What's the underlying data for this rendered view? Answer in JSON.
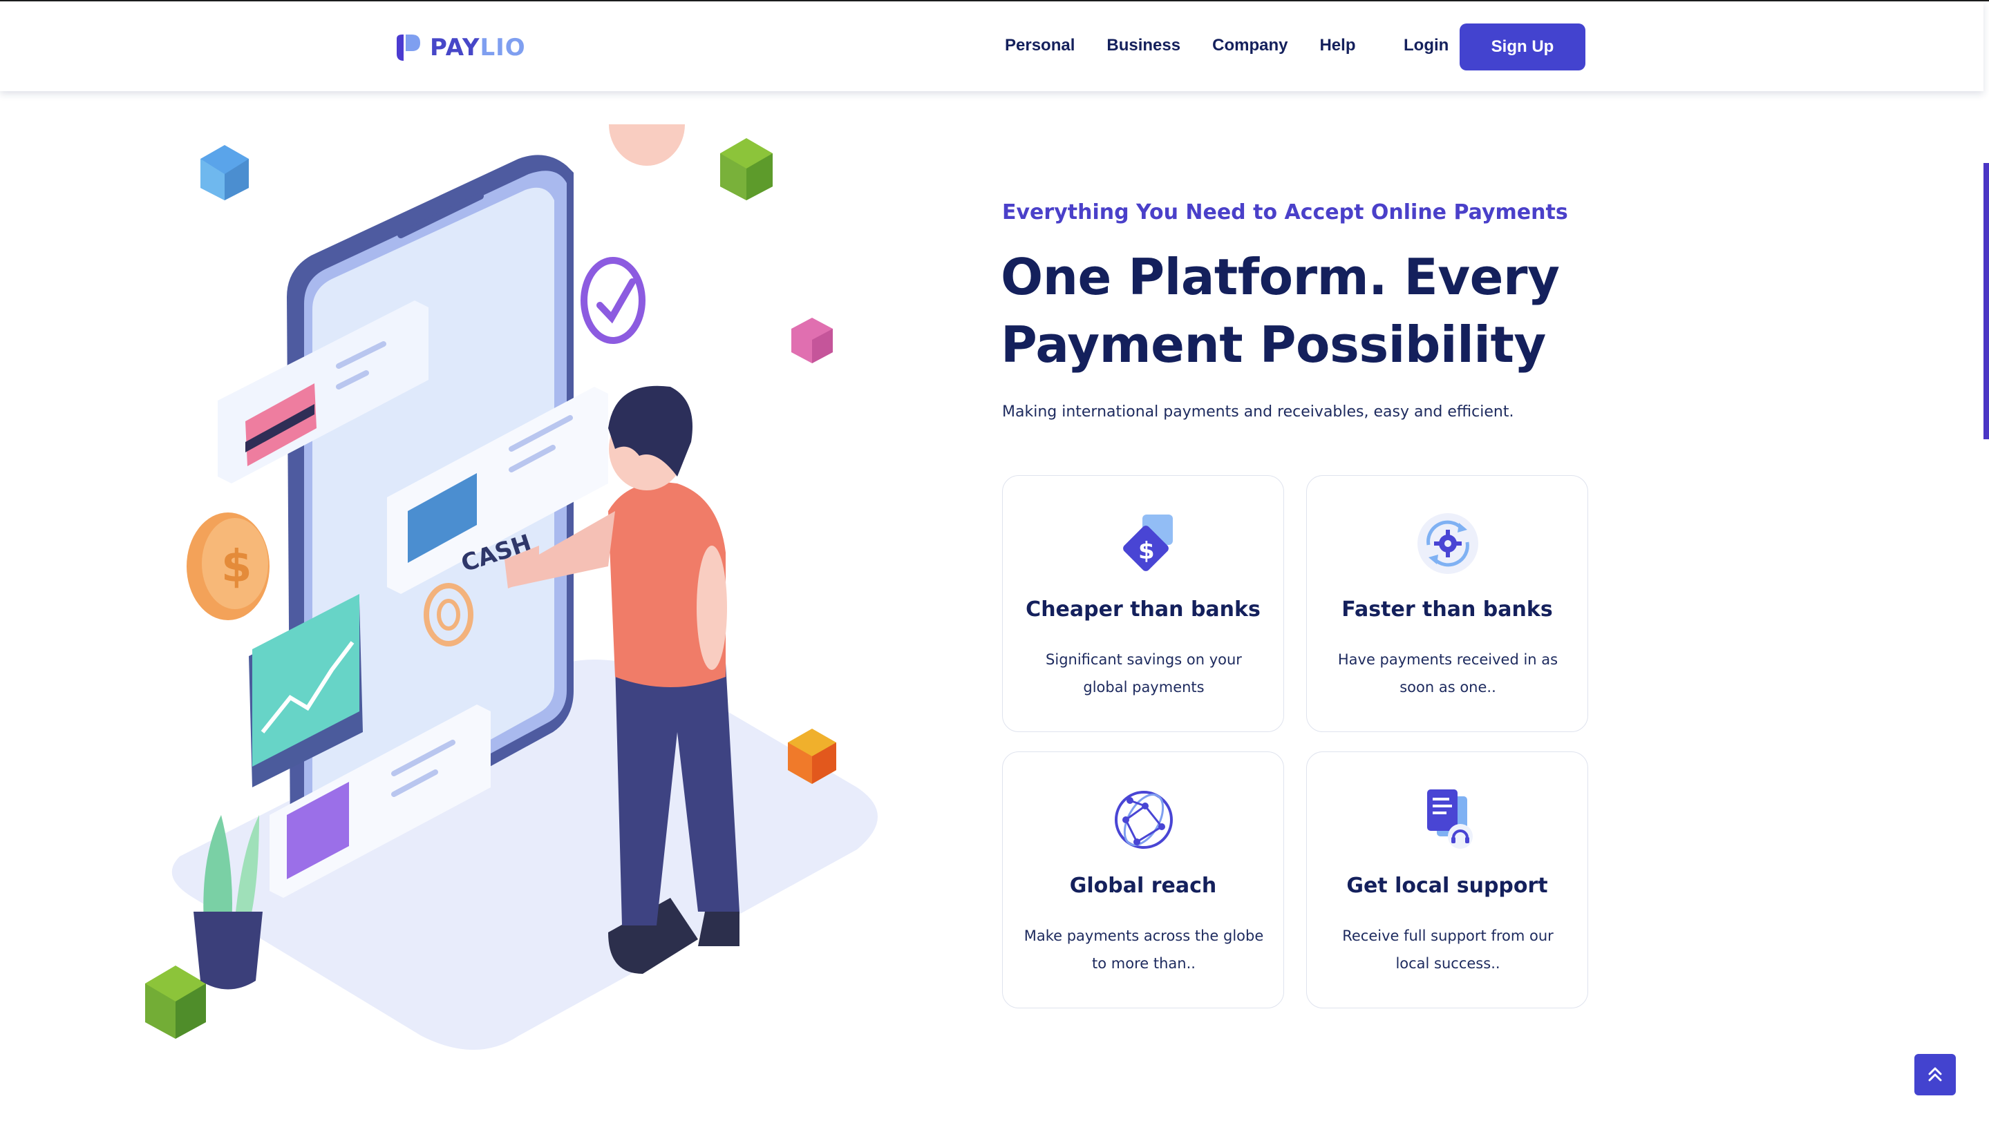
{
  "brand": {
    "name_part1": "PAY",
    "name_part2": "LIO",
    "colors": {
      "primary": "#4343cf",
      "navy": "#14205c",
      "light_blue": "#7f9ff0"
    }
  },
  "nav": {
    "items": [
      {
        "label": "Personal"
      },
      {
        "label": "Business"
      },
      {
        "label": "Company"
      },
      {
        "label": "Help"
      }
    ],
    "login_label": "Login",
    "signup_label": "Sign Up"
  },
  "hero": {
    "kicker": "Everything You Need to Accept Online Payments",
    "headline_line1": "One Platform. Every",
    "headline_line2": "Payment Possibility",
    "subline": "Making international payments and receivables, easy and efficient.",
    "illustration": {
      "icon": "person-using-phone-payments-illustration",
      "cash_text": "CASH"
    }
  },
  "features": [
    {
      "icon": "dollar-tag-icon",
      "title": "Cheaper than banks",
      "desc": "Significant savings on your global payments"
    },
    {
      "icon": "gear-sync-icon",
      "title": "Faster than banks",
      "desc": "Have payments received in as soon as one.."
    },
    {
      "icon": "network-globe-icon",
      "title": "Global reach",
      "desc": "Make payments across the globe to more than.."
    },
    {
      "icon": "document-support-icon",
      "title": "Get local support",
      "desc": "Receive full support from our local success.."
    }
  ],
  "back_to_top": {
    "icon": "double-chevron-up-icon"
  }
}
